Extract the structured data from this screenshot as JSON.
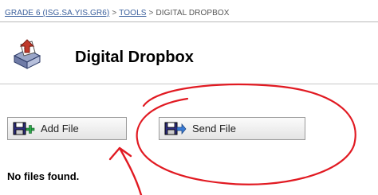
{
  "breadcrumb": {
    "course": "GRADE 6 (ISG.SA.YIS.GR6)",
    "tools": "TOOLS",
    "current": "DIGITAL DROPBOX",
    "separator": ">"
  },
  "page": {
    "title": "Digital Dropbox",
    "icon": "dropbox-icon"
  },
  "actions": {
    "add_file_label": "Add File",
    "add_file_icon": "add-file-icon",
    "send_file_label": "Send File",
    "send_file_icon": "send-file-icon"
  },
  "content": {
    "empty_message": "No files found."
  },
  "annotation": {
    "color": "#e11a22",
    "shapes": [
      "ellipse-around-send-file",
      "arrow-pointing-to-add-file"
    ]
  },
  "colors": {
    "link": "#3a5f9c",
    "button_border": "#9a9a9a"
  }
}
